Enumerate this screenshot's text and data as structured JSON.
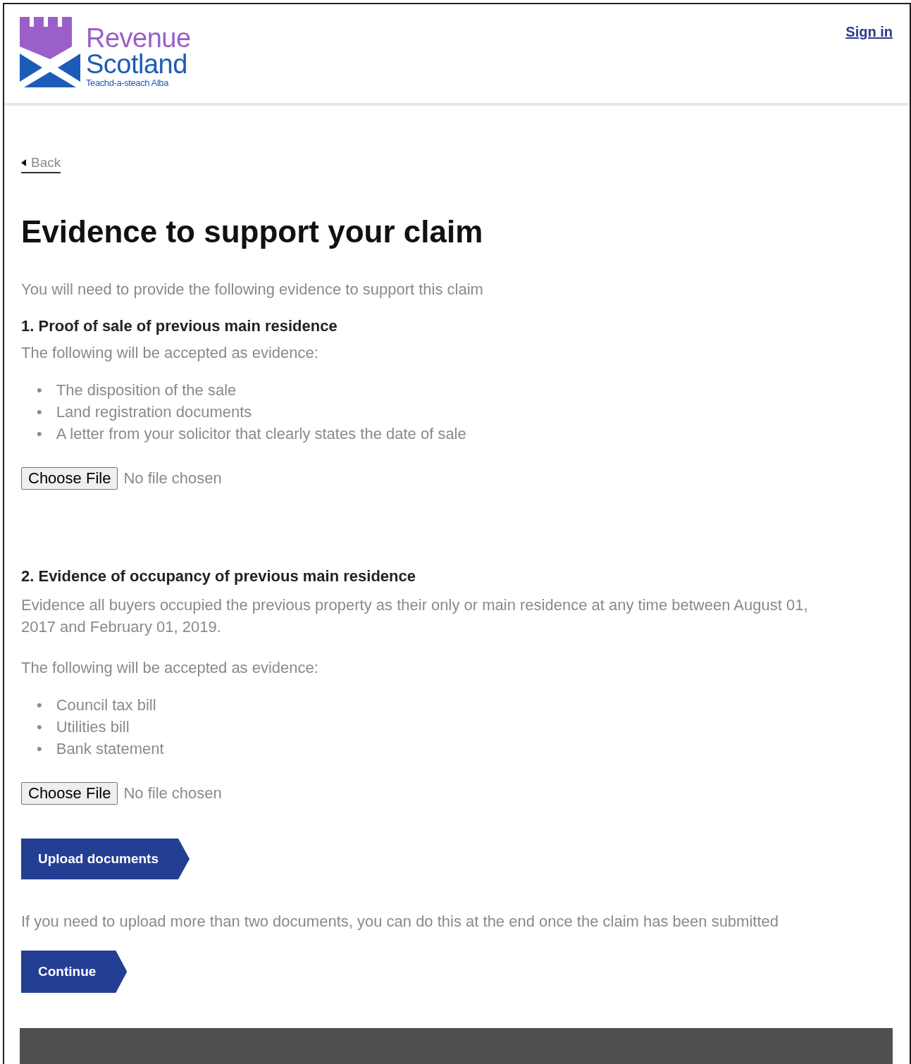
{
  "header": {
    "logo": {
      "line1": "Revenue",
      "line2": "Scotland",
      "tagline": "Teachd-a-steach Alba"
    },
    "sign_in": "Sign in"
  },
  "back_link": "Back",
  "title": "Evidence to support your claim",
  "intro": "You will need to provide the following evidence to support this claim",
  "sections": [
    {
      "heading": "1. Proof of sale of previous main residence",
      "accepted_label": "The following will be accepted as evidence:",
      "items": [
        {
          "marker": "•",
          "text": "The disposition of the sale"
        },
        {
          "marker": "•",
          "text": "Land registration documents"
        },
        {
          "marker": "•",
          "text": "A letter from your solicitor that clearly states the date of sale"
        }
      ],
      "file_input": {
        "button": "Choose File",
        "status": "No file chosen"
      }
    },
    {
      "heading": "2. Evidence of occupancy of previous main residence",
      "description": "Evidence all buyers occupied the previous property as their only or main residence at any time between August 01, 2017 and February 01, 2019.",
      "accepted_label": "The following will be accepted as evidence:",
      "items": [
        {
          "marker": "•",
          "text": "Council tax bill"
        },
        {
          "marker": "•",
          "text": "Utilities bill"
        },
        {
          "marker": "•",
          "text": "Bank statement"
        }
      ],
      "file_input": {
        "button": "Choose File",
        "status": "No file chosen"
      }
    }
  ],
  "upload_button": "Upload documents",
  "note": "If you need to upload more than two documents, you can do this at the end once the claim has been submitted",
  "continue_button": "Continue"
}
